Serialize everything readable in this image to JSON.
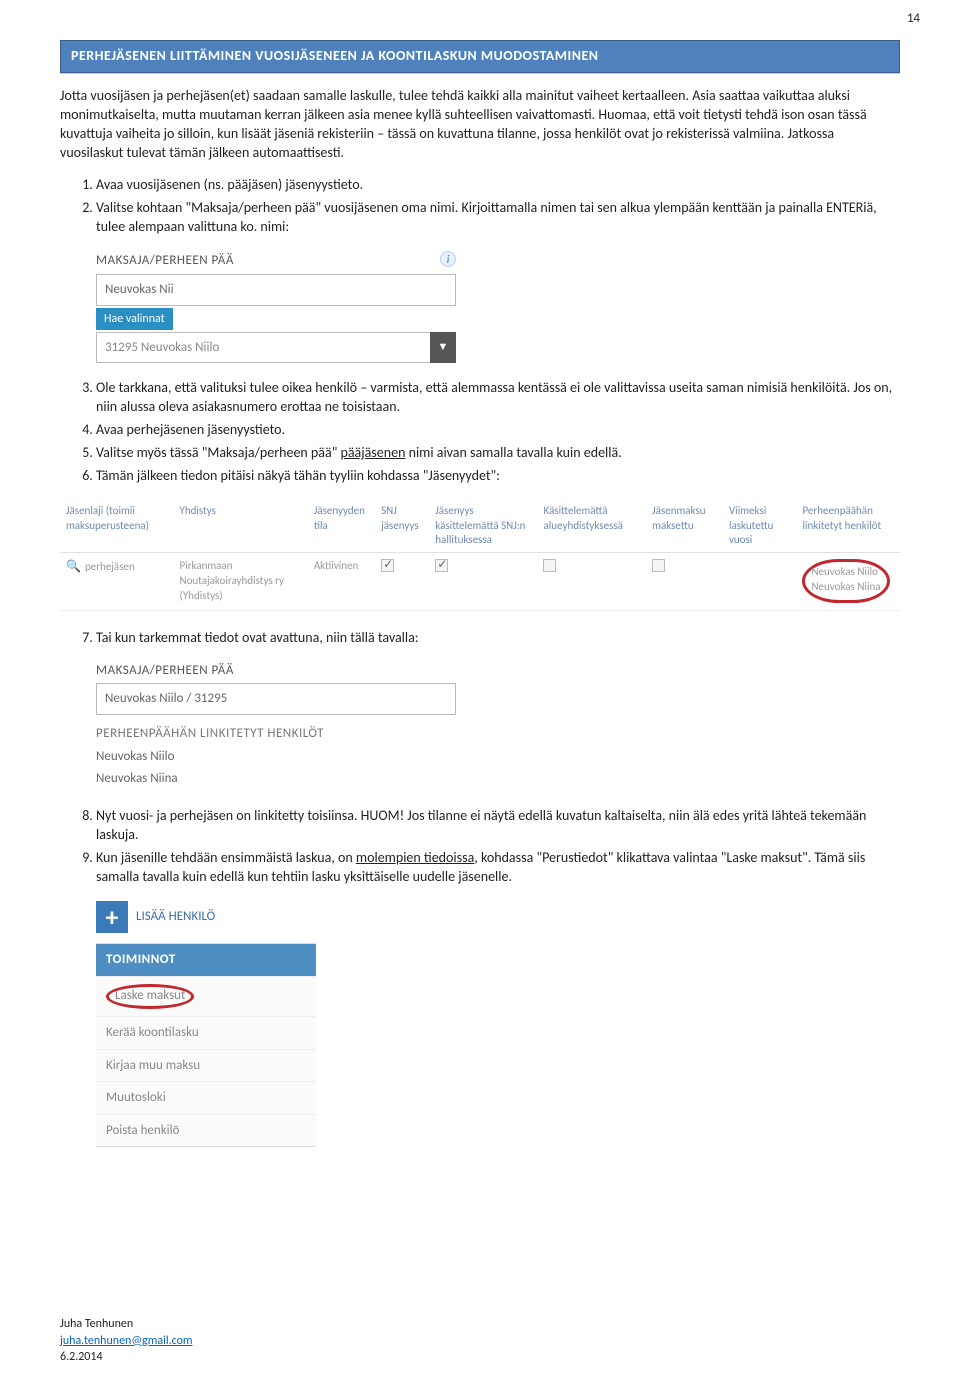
{
  "page_number": "14",
  "section_title": "PERHEJÄSENEN LIITTÄMINEN VUOSIJÄSENEEN JA KOONTILASKUN MUODOSTAMINEN",
  "intro_para": "Jotta vuosijäsen ja perhejäsen(et) saadaan samalle laskulle, tulee tehdä kaikki alla mainitut vaiheet kertaalleen. Asia saattaa vaikuttaa aluksi monimutkaiselta, mutta muutaman kerran jälkeen asia menee kyllä suhteellisen vaivattomasti. Huomaa, että voit tietysti tehdä ison osan tässä kuvattuja vaiheita jo silloin, kun lisäät jäseniä rekisteriin – tässä on kuvattuna tilanne, jossa henkilöt ovat jo rekisterissä valmiina. Jatkossa vuosilaskut tulevat tämän jälkeen automaattisesti.",
  "list1": {
    "i1": "Avaa vuosijäsenen (ns. pääjäsen) jäsenyystieto.",
    "i2": "Valitse kohtaan \"Maksaja/perheen pää\" vuosijäsenen oma nimi. Kirjoittamalla nimen tai sen alkua ylempään kenttään ja painalla ENTERiä, tulee alempaan valittuna ko. nimi:"
  },
  "ss1": {
    "label": "MAKSAJA/PERHEEN PÄÄ",
    "input_value": "Neuvokas Nii",
    "hae": "Hae valinnat",
    "select_value": "31295 Neuvokas Niilo"
  },
  "list2": {
    "i3": "Ole tarkkana, että valituksi tulee oikea henkilö – varmista, että alemmassa kentässä ei ole valittavissa useita saman nimisiä henkilöitä. Jos on, niin alussa oleva asiakasnumero erottaa ne toisistaan.",
    "i4": "Avaa perhejäsenen jäsenyystieto.",
    "i5_a": "Valitse myös tässä \"Maksaja/perheen pää\" ",
    "i5_u": "pääjäsenen",
    "i5_b": " nimi aivan samalla tavalla kuin edellä.",
    "i6": "Tämän jälkeen tiedon pitäisi näkyä tähän tyyliin kohdassa \"Jäsenyydet\":"
  },
  "ss2": {
    "headers": {
      "h1": "Jäsenlaji (toimii maksuperusteena)",
      "h2": "Yhdistys",
      "h3": "Jäsenyyden tila",
      "h4": "SNJ jäsenyys",
      "h5": "Jäsenyys käsittelemättä SNJ:n hallituksessa",
      "h6": "Käsittelemättä alueyhdistyksessä",
      "h7": "Jäsenmaksu maksettu",
      "h8": "Viimeksi laskutettu vuosi",
      "h9": "Perheenpäähän linkitetyt henkilöt"
    },
    "row": {
      "c1": "perhejäsen",
      "c2": "Pirkanmaan Noutajakoirayhdistys ry (Yhdistys)",
      "c3": "Aktiivinen",
      "c9a": "Neuvokas Niilo",
      "c9b": "Neuvokas Niina"
    }
  },
  "list3": {
    "i7": "Tai kun tarkemmat tiedot ovat avattuna, niin tällä tavalla:"
  },
  "ss3": {
    "label1": "MAKSAJA/PERHEEN PÄÄ",
    "val1": "Neuvokas Niilo / 31295",
    "label2": "PERHEENPÄÄHÄN LINKITETYT HENKILÖT",
    "p1": "Neuvokas Niilo",
    "p2": "Neuvokas Niina"
  },
  "list4": {
    "i8": "Nyt vuosi- ja perhejäsen on linkitetty toisiinsa. HUOM! Jos tilanne ei näytä edellä kuvatun kaltaiselta, niin älä edes yritä lähteä tekemään laskuja.",
    "i9_a": "Kun jäsenille tehdään ensimmäistä laskua, on ",
    "i9_u": "molempien tiedoissa",
    "i9_b": ", kohdassa \"Perustiedot\" klikattava valintaa \"Laske maksut\". Tämä siis samalla tavalla kuin edellä kun tehtiin lasku yksittäiselle uudelle jäsenelle."
  },
  "ss4": {
    "add": "LISÄÄ HENKILÖ",
    "head": "TOIMINNOT",
    "i1": "Laske maksut",
    "i2": "Kerää koontilasku",
    "i3": "Kirjaa muu maksu",
    "i4": "Muutosloki",
    "i5": "Poista henkilö"
  },
  "footer": {
    "name": "Juha Tenhunen",
    "email": "juha.tenhunen@gmail.com",
    "date": "6.2.2014"
  }
}
